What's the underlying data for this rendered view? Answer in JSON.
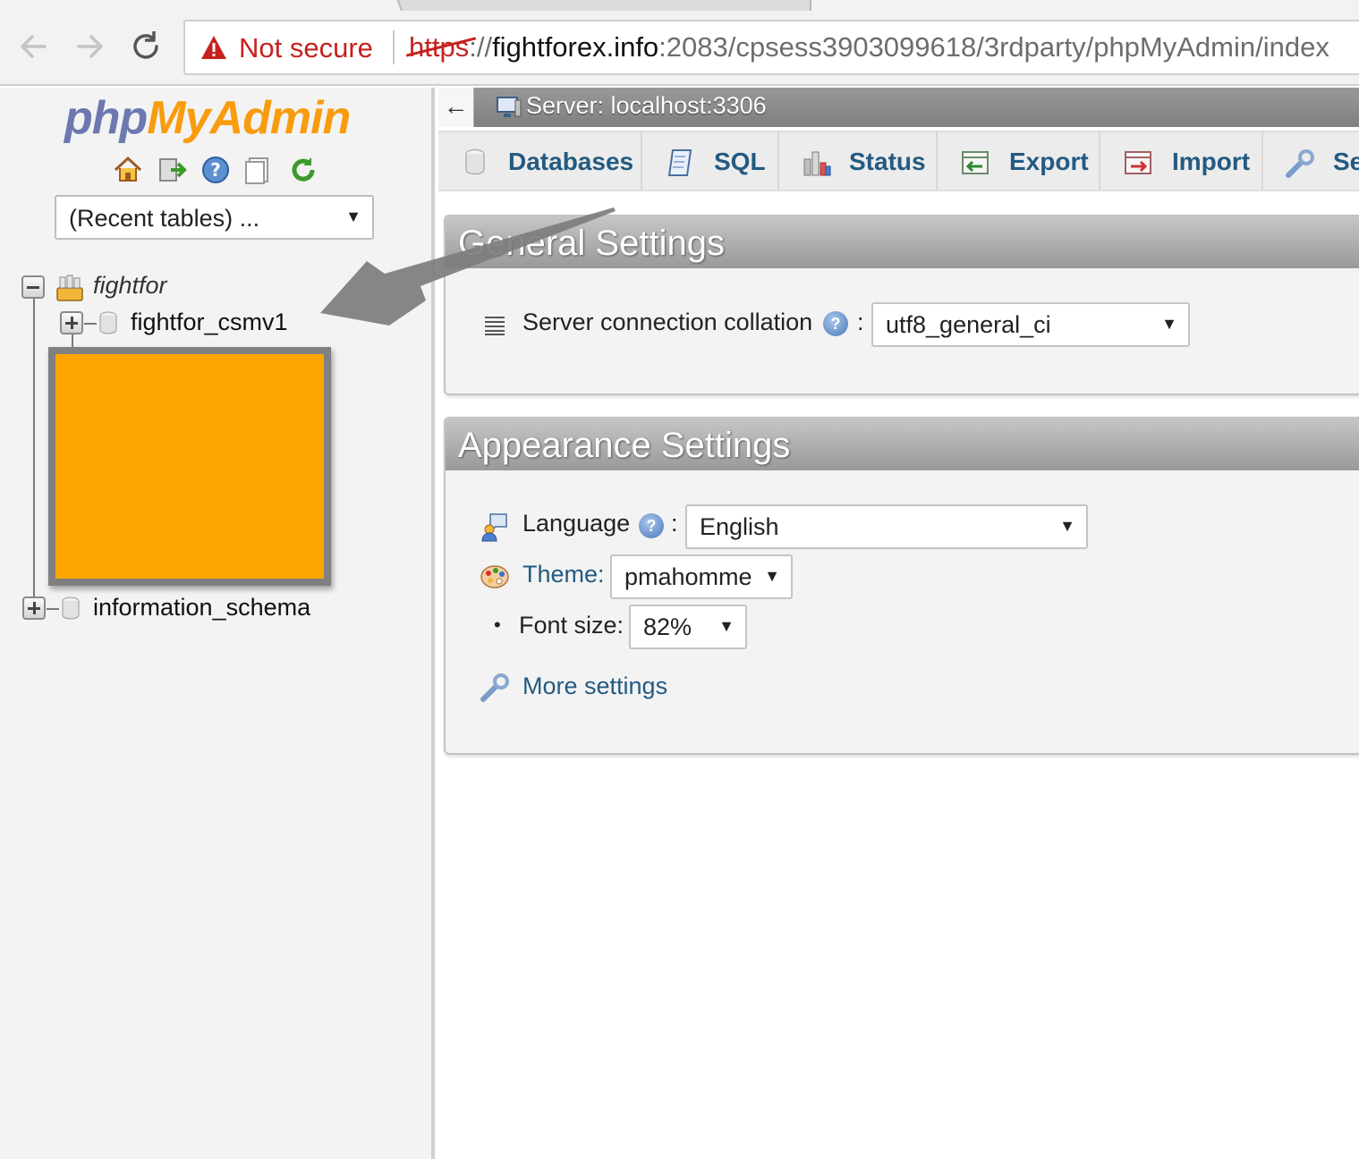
{
  "browser": {
    "security_label": "Not secure",
    "url_scheme": "https",
    "url_sep": "://",
    "url_host": "fightforex.info",
    "url_path": ":2083/cpsess3903099618/3rdparty/phpMyAdmin/index"
  },
  "sidebar": {
    "logo_php": "php",
    "logo_myadmin": "MyAdmin",
    "nav_icons": [
      "home-icon",
      "logout-icon",
      "help-icon",
      "docs-icon",
      "reload-icon"
    ],
    "recent_tables": "(Recent tables) ...",
    "tree": {
      "group": "fightfor",
      "databases": [
        "fightfor_csmv1"
      ],
      "other": "information_schema"
    }
  },
  "server_bar": {
    "label": "Server: localhost:3306",
    "collapse_glyph": "←"
  },
  "tabs": [
    {
      "label": "Databases",
      "icon": "database-icon"
    },
    {
      "label": "SQL",
      "icon": "sql-icon"
    },
    {
      "label": "Status",
      "icon": "status-icon"
    },
    {
      "label": "Export",
      "icon": "export-icon"
    },
    {
      "label": "Import",
      "icon": "import-icon"
    },
    {
      "label": "Se",
      "icon": "settings-icon"
    }
  ],
  "general_settings": {
    "title": "General Settings",
    "collation_label": "Server connection collation",
    "collation_value": "utf8_general_ci"
  },
  "appearance_settings": {
    "title": "Appearance Settings",
    "language_label": "Language",
    "language_value": "English",
    "theme_label": "Theme:",
    "theme_value": "pmahomme",
    "font_size_label": "Font size:",
    "font_size_value": "82%",
    "more_settings": "More settings"
  },
  "colors": {
    "accent_link": "#235a81",
    "logo_orange": "#f89c0e",
    "logo_blue": "#6c78af",
    "redaction": "#ffa500"
  }
}
